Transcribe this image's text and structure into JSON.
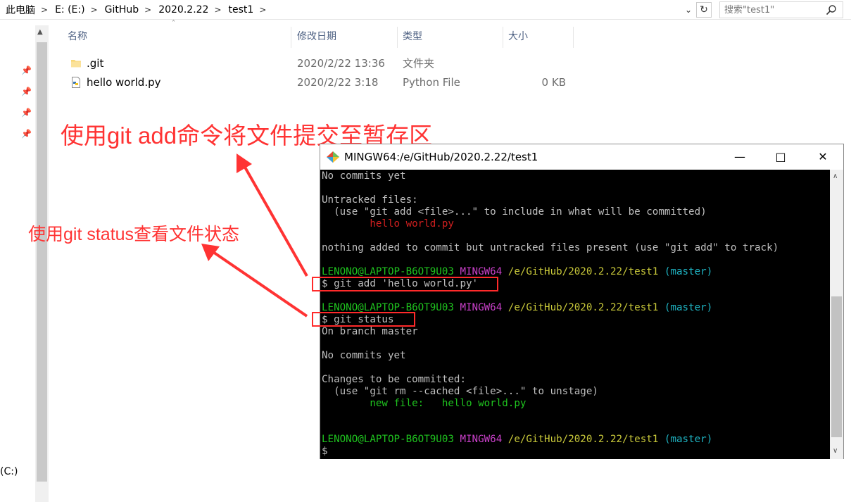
{
  "address_bar": {
    "crumbs": [
      "此电脑",
      "E: (E:)",
      "GitHub",
      "2020.2.22",
      "test1"
    ],
    "search_placeholder": "搜索\"test1\""
  },
  "nav": {
    "drive_label": "(C:)"
  },
  "file_list": {
    "columns": [
      "名称",
      "修改日期",
      "类型",
      "大小"
    ],
    "rows": [
      {
        "name": ".git",
        "date": "2020/2/22 13:36",
        "type": "文件夹",
        "size": "",
        "icon": "folder-icon"
      },
      {
        "name": "hello world.py",
        "date": "2020/2/22 3:18",
        "type": "Python File",
        "size": "0 KB",
        "icon": "python-file-icon"
      }
    ]
  },
  "annotations": {
    "add_note": "使用git add命令将文件提交至暂存区",
    "status_note": "使用git status查看文件状态"
  },
  "terminal": {
    "title": "MINGW64:/e/GitHub/2020.2.22/test1",
    "lines": {
      "l1": "No commits yet",
      "l2": "Untracked files:",
      "l3": "  (use \"git add <file>...\" to include in what will be committed)",
      "l4": "        hello world.py",
      "l5": "nothing added to commit but untracked files present (use \"git add\" to track)",
      "prompt_user": "LENONO@LAPTOP-B6OT9U03",
      "prompt_env": "MINGW64",
      "prompt_path": "/e/GitHub/2020.2.22/test1",
      "prompt_branch": "(master)",
      "cmd_add": "$ git add 'hello world.py'",
      "cmd_status": "$ git status",
      "l6": "On branch master",
      "l7": "No commits yet",
      "l8": "Changes to be committed:",
      "l9": "  (use \"git rm --cached <file>...\" to unstage)",
      "l10": "        new file:   hello world.py",
      "final_prompt": "$"
    }
  },
  "colors": {
    "annotation_red": "#ff3333",
    "terminal_bg": "#000000",
    "prompt_green": "#1fc41f",
    "prompt_magenta": "#c940c9",
    "prompt_yellow": "#c9c93a",
    "prompt_cyan": "#1fb5c4",
    "untracked_red": "#d01f1f"
  }
}
